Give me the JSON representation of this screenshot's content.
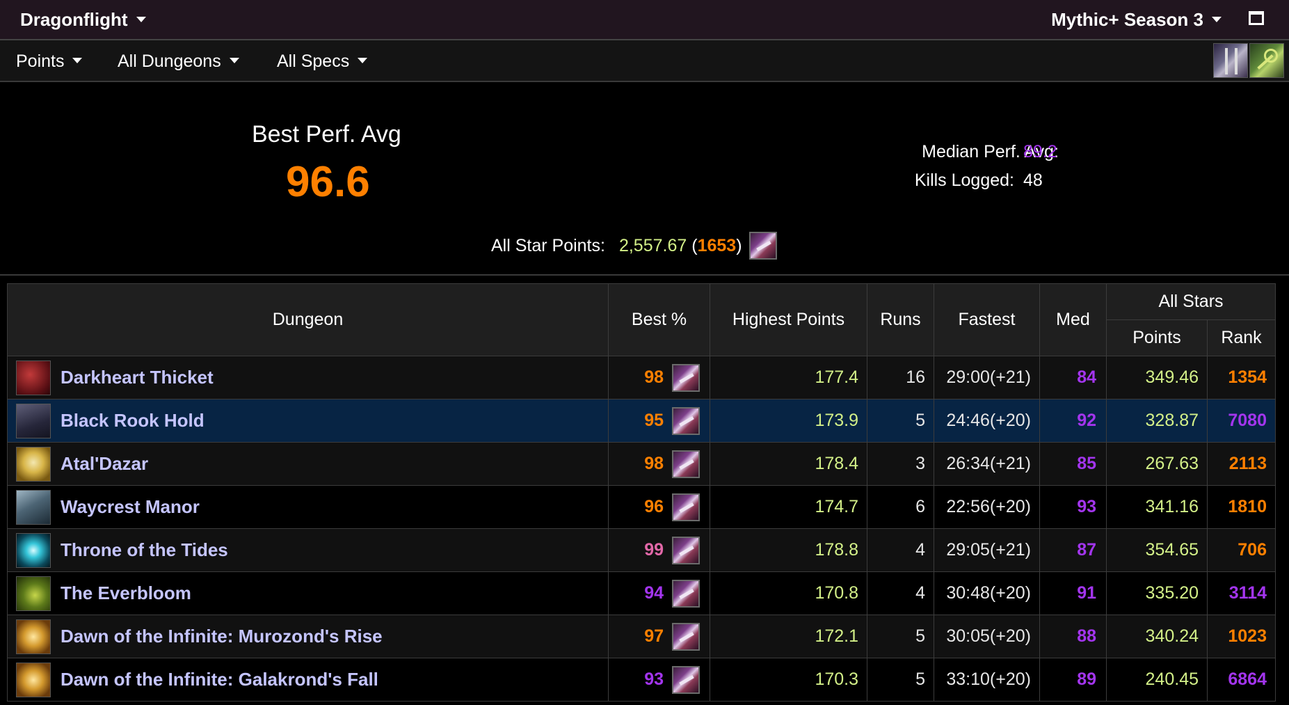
{
  "header": {
    "expansion": "Dragonflight",
    "season": "Mythic+ Season 3"
  },
  "filters": {
    "metric": "Points",
    "dungeons": "All Dungeons",
    "specs": "All Specs"
  },
  "summary": {
    "best_perf_label": "Best Perf. Avg",
    "best_perf_value": "96.6",
    "median_label": "Median Perf. Avg:",
    "median_value": "89.2",
    "kills_label": "Kills Logged:",
    "kills_value": "48",
    "allstar_label": "All Star Points:",
    "allstar_points": "2,557.67",
    "allstar_open": " (",
    "allstar_rank": "1653",
    "allstar_close": ")"
  },
  "table": {
    "headers": {
      "dungeon": "Dungeon",
      "best": "Best %",
      "highest": "Highest Points",
      "runs": "Runs",
      "fastest": "Fastest",
      "med": "Med",
      "allstars": "All Stars",
      "points": "Points",
      "rank": "Rank"
    },
    "rows": [
      {
        "name": "Darkheart Thicket",
        "best": "98",
        "highest": "177.4",
        "runs": "16",
        "fastest": "29:00(+21)",
        "med": "84",
        "points": "349.46",
        "rank": "1354"
      },
      {
        "name": "Black Rook Hold",
        "best": "95",
        "highest": "173.9",
        "runs": "5",
        "fastest": "24:46(+20)",
        "med": "92",
        "points": "328.87",
        "rank": "7080"
      },
      {
        "name": "Atal'Dazar",
        "best": "98",
        "highest": "178.4",
        "runs": "3",
        "fastest": "26:34(+21)",
        "med": "85",
        "points": "267.63",
        "rank": "2113"
      },
      {
        "name": "Waycrest Manor",
        "best": "96",
        "highest": "174.7",
        "runs": "6",
        "fastest": "22:56(+20)",
        "med": "93",
        "points": "341.16",
        "rank": "1810"
      },
      {
        "name": "Throne of the Tides",
        "best": "99",
        "highest": "178.8",
        "runs": "4",
        "fastest": "29:05(+21)",
        "med": "87",
        "points": "354.65",
        "rank": "706"
      },
      {
        "name": "The Everbloom",
        "best": "94",
        "highest": "170.8",
        "runs": "4",
        "fastest": "30:48(+20)",
        "med": "91",
        "points": "335.20",
        "rank": "3114"
      },
      {
        "name": "Dawn of the Infinite: Murozond's Rise",
        "best": "97",
        "highest": "172.1",
        "runs": "5",
        "fastest": "30:05(+20)",
        "med": "88",
        "points": "340.24",
        "rank": "1023"
      },
      {
        "name": "Dawn of the Infinite: Galakrond's Fall",
        "best": "93",
        "highest": "170.3",
        "runs": "5",
        "fastest": "33:10(+20)",
        "med": "89",
        "points": "240.45",
        "rank": "6864"
      }
    ]
  },
  "colors": {
    "legendary": "#ff8000",
    "epic": "#a335ee",
    "pink": "#e268a8",
    "points_green": "#d3f088",
    "dungeon_name": "#c5c5ff",
    "selected_row": "#072444",
    "topbar_bg": "#21151f"
  },
  "icons": {
    "expansion_dropdown": "chevron-down-icon",
    "maximize": "maximize-icon",
    "character_swords": "swords-icon",
    "mythic_key": "keystone-icon",
    "spec": "rogue-spec-icon"
  }
}
